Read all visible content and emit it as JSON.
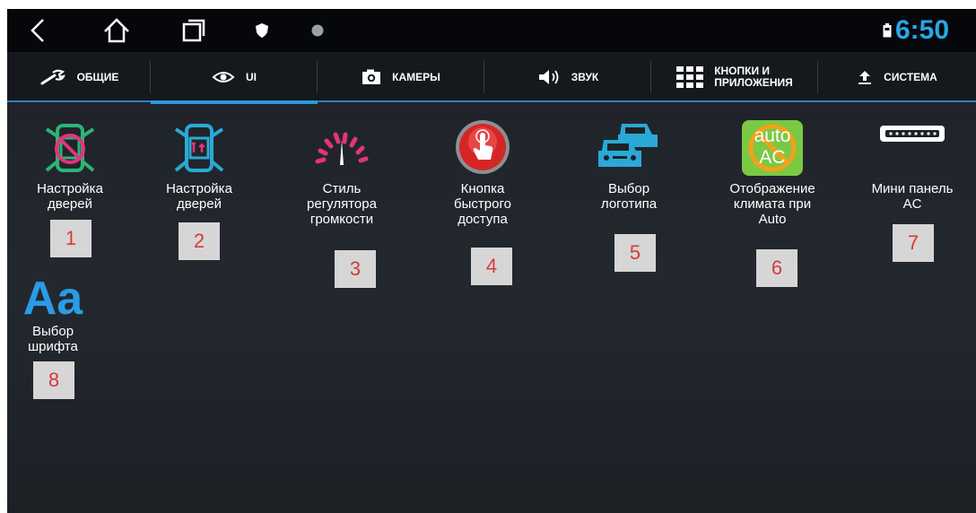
{
  "status_bar": {
    "time": "6:50",
    "icons": [
      "back-icon",
      "home-icon",
      "recent-apps-icon",
      "shield-icon",
      "dot-icon",
      "battery-icon"
    ]
  },
  "tabs": [
    {
      "label": "ОБЩИЕ",
      "icon": "wrench-icon",
      "active": false
    },
    {
      "label": "UI",
      "icon": "eye-icon",
      "active": true
    },
    {
      "label": "КАМЕРЫ",
      "icon": "camera-icon",
      "active": false
    },
    {
      "label": "ЗВУК",
      "icon": "speaker-icon",
      "active": false
    },
    {
      "label": "КНОПКИ И\nПРИЛОЖЕНИЯ",
      "icon": "grid-icon",
      "active": false
    },
    {
      "label": "СИСТЕМА",
      "icon": "upload-icon",
      "active": false
    }
  ],
  "items": [
    {
      "label": "Настройка\nдверей",
      "icon": "door-disabled-icon",
      "number": "1"
    },
    {
      "label": "Настройка\nдверей",
      "icon": "door-settings-icon",
      "number": "2"
    },
    {
      "label": "Стиль\nрегулятора\nгромкости",
      "icon": "volume-gauge-icon",
      "number": "3"
    },
    {
      "label": "Кнопка\nбыстрого\nдоступа",
      "icon": "quick-access-button-icon",
      "number": "4"
    },
    {
      "label": "Выбор\nлоготипа",
      "icon": "cars-logo-icon",
      "number": "5"
    },
    {
      "label": "Отображение\nклимата при\nAuto",
      "icon": "auto-ac-icon",
      "icon_text": "auto\nAC",
      "number": "6"
    },
    {
      "label": "Мини панель\nAC",
      "icon": "mini-panel-icon",
      "number": "7"
    },
    {
      "label": "Выбор\nшрифта",
      "icon": "font-aa-icon",
      "icon_text": "Aa",
      "number": "8"
    }
  ],
  "colors": {
    "accent": "#2b9be0",
    "clock": "#29a6e8",
    "number_text": "#d63a3a",
    "number_bg": "#d6d6d6"
  }
}
